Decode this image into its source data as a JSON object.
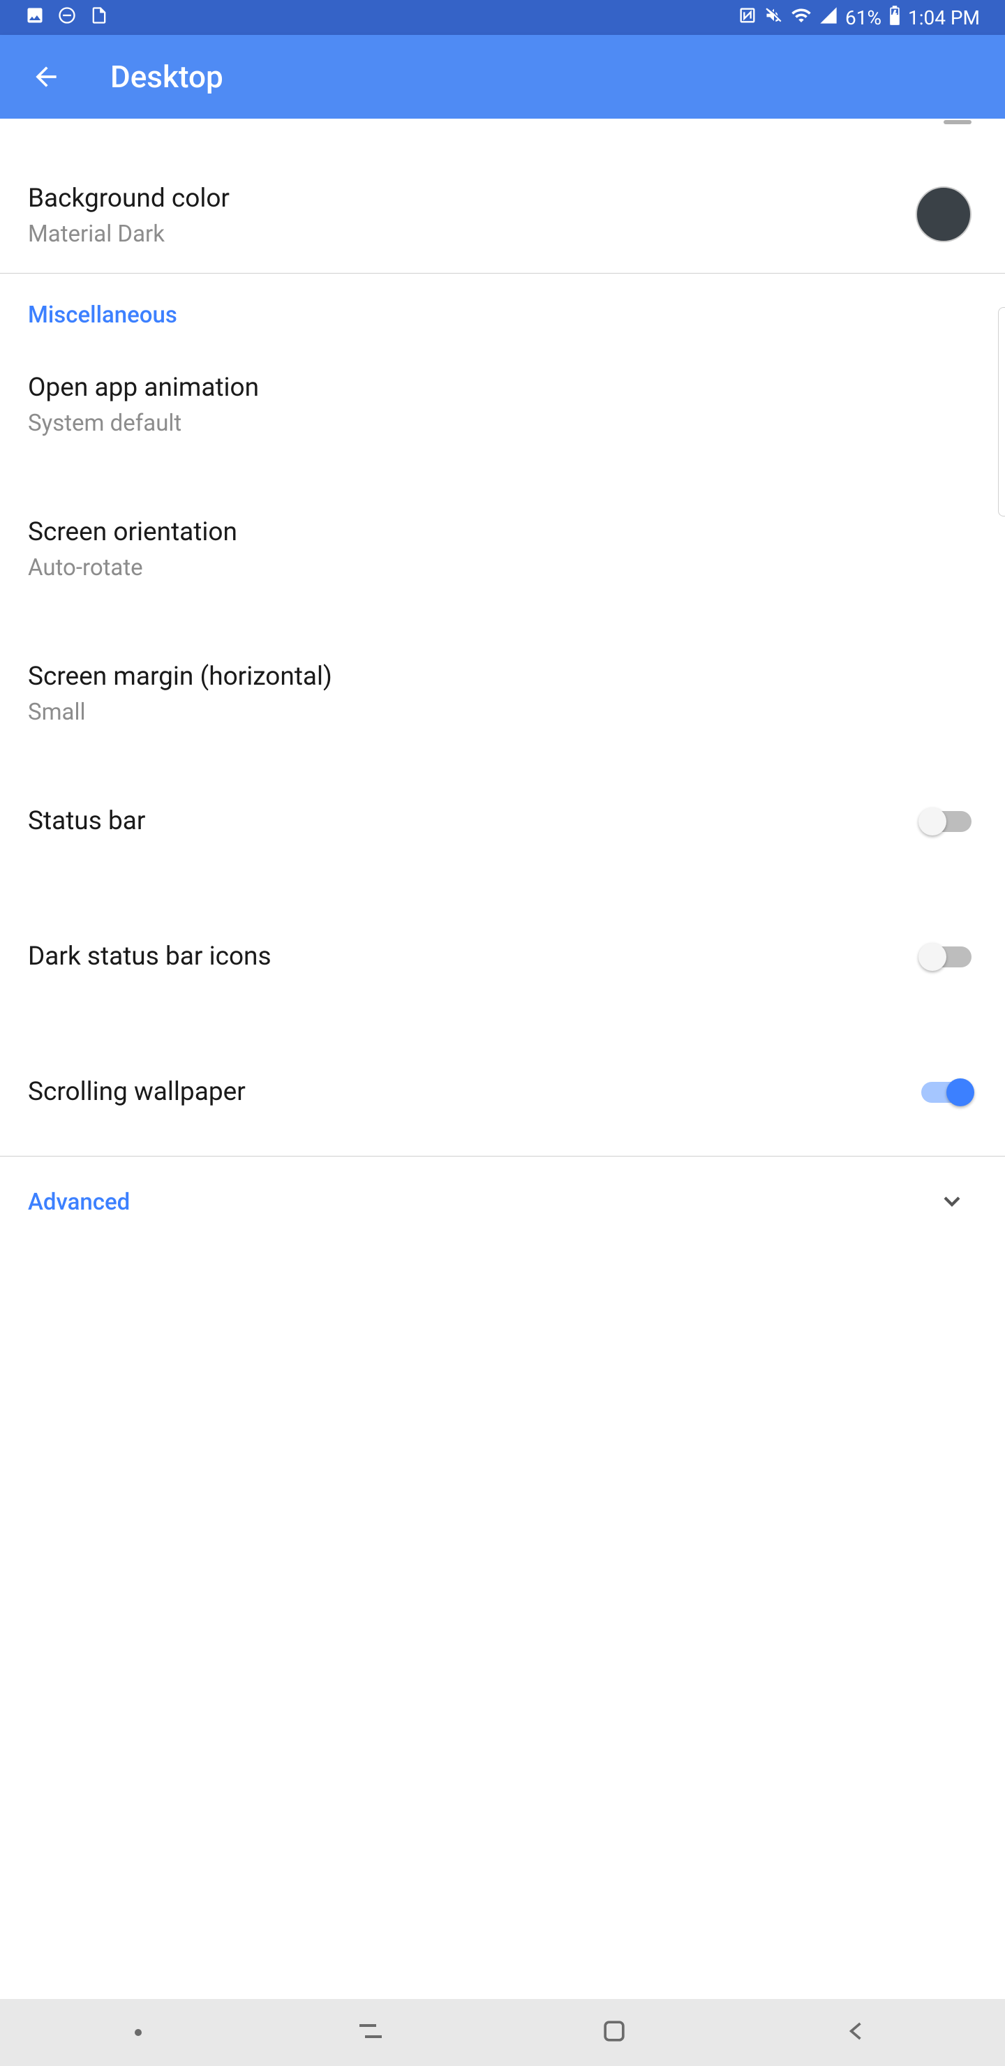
{
  "statusbar": {
    "battery_pct": "61%",
    "time": "1:04 PM"
  },
  "appbar": {
    "title": "Desktop"
  },
  "rows": {
    "bg_color": {
      "title": "Background color",
      "sub": "Material Dark",
      "swatch": "#3a4147"
    },
    "section_misc": "Miscellaneous",
    "open_anim": {
      "title": "Open app animation",
      "sub": "System default"
    },
    "orientation": {
      "title": "Screen orientation",
      "sub": "Auto-rotate"
    },
    "margin": {
      "title": "Screen margin (horizontal)",
      "sub": "Small"
    },
    "status_bar": {
      "title": "Status bar",
      "on": false
    },
    "dark_icons": {
      "title": "Dark status bar icons",
      "on": false
    },
    "scroll_wp": {
      "title": "Scrolling wallpaper",
      "on": true
    },
    "advanced": "Advanced"
  }
}
